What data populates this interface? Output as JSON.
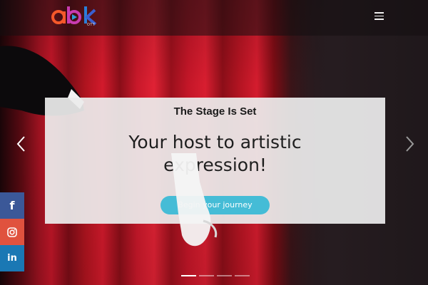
{
  "header": {
    "logo_text": "abk",
    "logo_sub": "OTT",
    "menu_icon": "hamburger-icon"
  },
  "slide": {
    "kicker": "The Stage Is Set",
    "headline": "Your host to artistic expression!",
    "cta_label": "Begin your journey"
  },
  "carousel": {
    "prev_icon": "chevron-left-icon",
    "next_icon": "chevron-right-icon",
    "slide_count": 4,
    "active_index": 0
  },
  "social": [
    {
      "name": "facebook",
      "icon": "facebook-icon",
      "glyph": "f",
      "color": "#3b5898"
    },
    {
      "name": "instagram",
      "icon": "instagram-icon",
      "glyph": "◎",
      "color": "#e0523e"
    },
    {
      "name": "linkedin",
      "icon": "linkedin-icon",
      "glyph": "in",
      "color": "#1a78b4"
    }
  ],
  "colors": {
    "accent": "#45bcd6",
    "logo_a": "#f5582a",
    "logo_b": "#2a7fd8",
    "logo_k": "#3a5fd0"
  }
}
